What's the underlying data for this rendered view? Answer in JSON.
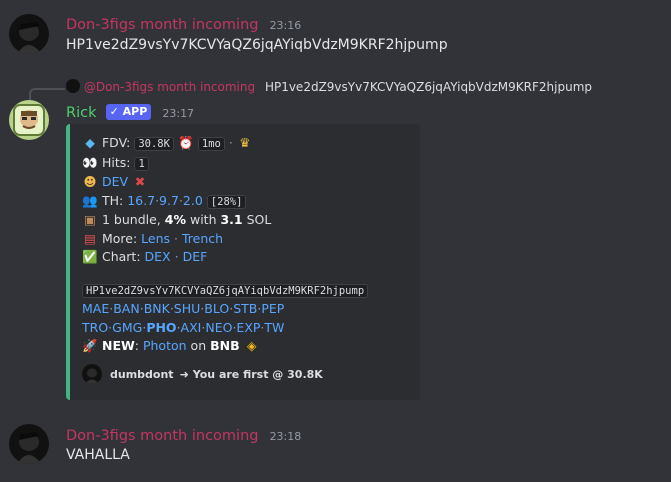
{
  "messages": [
    {
      "author": "Don-3figs month incoming",
      "time": "23:16",
      "text": "HP1ve2dZ9vsYv7KCVYaQZ6jqAYiqbVdzM9KRF2hjpump"
    },
    {
      "reply_to_author": "@Don-3figs month incoming",
      "reply_to_text": "HP1ve2dZ9vsYv7KCVYaQZ6jqAYiqbVdzM9KRF2hjpump",
      "author": "Rick",
      "badge": "✓ APP",
      "time": "23:17"
    },
    {
      "author": "Don-3figs month incoming",
      "time": "23:18",
      "text": "VAHALLA"
    }
  ],
  "embed": {
    "fdv_label": "FDV:",
    "fdv_value": "30.8K",
    "fdv_age": "1mo",
    "hits_label": "Hits:",
    "hits_value": "1",
    "dev_label": "DEV",
    "th_label": "TH:",
    "th_values": [
      "16.7",
      "9.7",
      "2.0"
    ],
    "th_total": "[28%]",
    "bundle_text_1": "1 bundle,",
    "bundle_pct": "4%",
    "bundle_text_2": "with",
    "bundle_sol": "3.1",
    "bundle_text_3": "SOL",
    "more_label": "More:",
    "more_links": [
      "Lens",
      "Trench"
    ],
    "chart_label": "Chart:",
    "chart_links": [
      "DEX",
      "DEF"
    ],
    "contract": "HP1ve2dZ9vsYv7KCVYaQZ6jqAYiqbVdzM9KRF2hjpump",
    "row1_links": [
      "MAE",
      "BAN",
      "BNK",
      "SHU",
      "BLO",
      "STB",
      "PEP"
    ],
    "row2_links": [
      "TRO",
      "GMG",
      "PHO",
      "AXI",
      "NEO",
      "EXP",
      "TW"
    ],
    "new_label": "NEW",
    "new_link": "Photon",
    "new_on": "on",
    "new_chain": "BNB",
    "footer_name": "dumbdont",
    "footer_text": "You are first @ 30.8K"
  },
  "colors": {
    "author_pink": "#c4365f",
    "rick_green": "#4fd06b",
    "embed_border": "#43b581",
    "link_blue": "#58a6ff"
  },
  "icons": {
    "fdv": "gem-icon",
    "age": "alarm-clock-icon",
    "crown": "crown-icon",
    "hits": "eyes-icon",
    "dev": "person-icon",
    "dev_flag": "cross-icon",
    "th": "people-icon",
    "bundle": "package-icon",
    "more": "film-icon",
    "chart": "chart-icon",
    "new": "rocket-icon",
    "chain": "bnb-icon",
    "footer_arrow": "arrow-icon"
  }
}
